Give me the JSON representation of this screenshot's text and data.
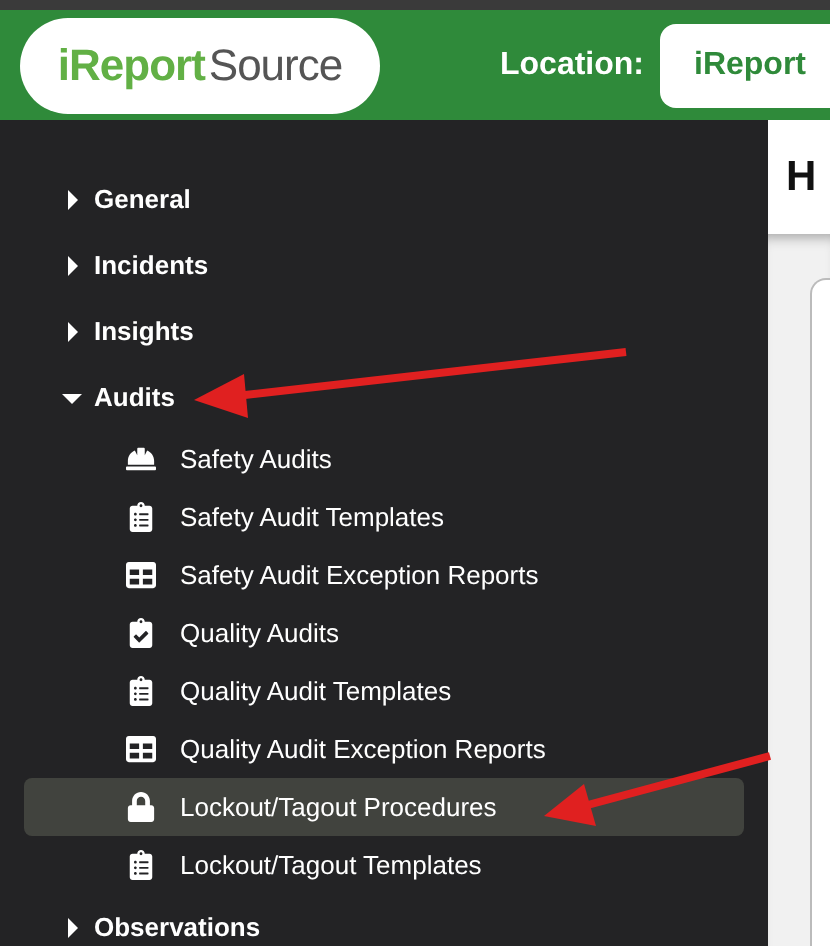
{
  "header": {
    "logo": {
      "accent": "iReport",
      "rest": "Source"
    },
    "location_label": "Location:",
    "location_value": "iReport"
  },
  "sidebar": {
    "groups": [
      {
        "label": "General",
        "expanded": false
      },
      {
        "label": "Incidents",
        "expanded": false
      },
      {
        "label": "Insights",
        "expanded": false
      },
      {
        "label": "Audits",
        "expanded": true,
        "children": [
          {
            "label": "Safety Audits",
            "kind": "safety",
            "selected": false
          },
          {
            "label": "Safety Audit Templates",
            "kind": "template",
            "selected": false
          },
          {
            "label": "Safety Audit Exception Reports",
            "kind": "report",
            "selected": false
          },
          {
            "label": "Quality Audits",
            "kind": "checklist",
            "selected": false
          },
          {
            "label": "Quality Audit Templates",
            "kind": "template",
            "selected": false
          },
          {
            "label": "Quality Audit Exception Reports",
            "kind": "report",
            "selected": false
          },
          {
            "label": "Lockout/Tagout Procedures",
            "kind": "procedure",
            "selected": true
          },
          {
            "label": "Lockout/Tagout Templates",
            "kind": "template",
            "selected": false
          }
        ]
      },
      {
        "label": "Observations",
        "expanded": false
      }
    ]
  },
  "main": {
    "heading": "H"
  }
}
